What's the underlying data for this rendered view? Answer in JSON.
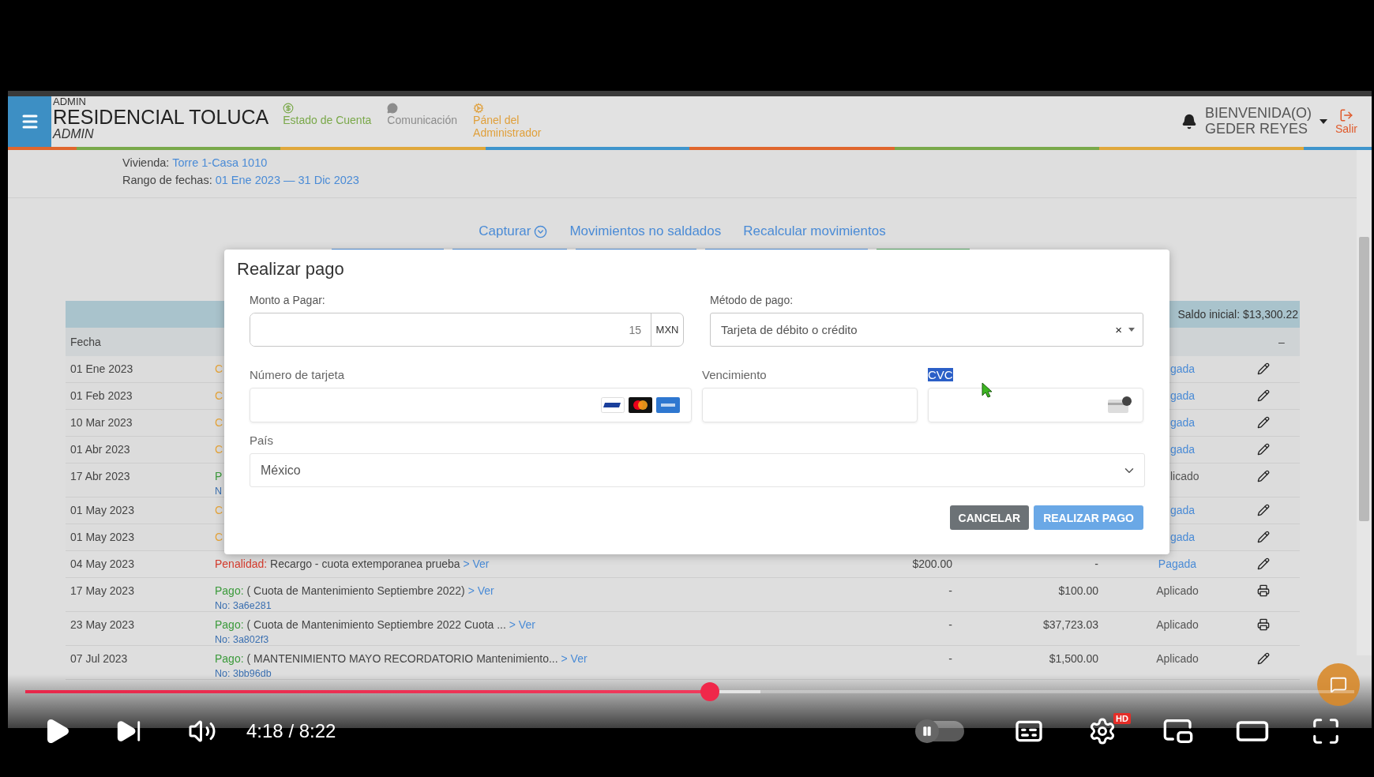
{
  "app": {
    "role_top": "ADMIN",
    "name": "RESIDENCIAL TOLUCA",
    "role_bottom": "ADMIN",
    "nav": [
      {
        "label": "Estado de Cuenta",
        "kind": "account",
        "color": "#7aa84a"
      },
      {
        "label": "Comunicación",
        "kind": "chat",
        "color": "#8c8c8c"
      },
      {
        "label": "Pánel del Administrador",
        "kind": "admin",
        "color": "#e0a03c"
      }
    ],
    "user": {
      "greeting": "BIENVENIDA(O)",
      "name": "GEDER REYES",
      "logout": "Salir"
    }
  },
  "info": [
    {
      "label": "Vivienda:",
      "value": "Torre 1-Casa 1010"
    },
    {
      "label": "Rango de fechas:",
      "value": "01 Ene 2023 — 31 Dic 2023"
    }
  ],
  "tabs": [
    {
      "label": "Capturar",
      "kind": "dropdown"
    },
    {
      "label": "Movimientos no saldados",
      "kind": "link"
    },
    {
      "label": "Recalcular movimientos",
      "kind": "link"
    }
  ],
  "table": {
    "balance": "Saldo inicial: $13,300.22",
    "date_header": "Fecha",
    "action_header": "–",
    "rows": [
      {
        "date": "01 Ene 2023",
        "kind": "cargo",
        "label": "C",
        "status": {
          "text": "gada",
          "color": "#4a8bd6"
        },
        "printable": false,
        "covered": true
      },
      {
        "date": "01 Feb 2023",
        "kind": "cargo",
        "label": "C",
        "status": {
          "text": "gada",
          "color": "#4a8bd6"
        },
        "printable": false,
        "covered": true
      },
      {
        "date": "10 Mar 2023",
        "kind": "cargo",
        "label": "C",
        "status": {
          "text": "gada",
          "color": "#4a8bd6"
        },
        "printable": false,
        "covered": true
      },
      {
        "date": "01 Abr 2023",
        "kind": "cargo",
        "label": "C",
        "status": {
          "text": "gada",
          "color": "#4a8bd6"
        },
        "printable": false,
        "covered": true
      },
      {
        "date": "17 Abr 2023",
        "kind": "pago",
        "label": "P",
        "ref": "N",
        "status": {
          "text": "licado",
          "color": "#555555"
        },
        "printable": false,
        "covered": true
      },
      {
        "date": "01 May 2023",
        "kind": "cargo",
        "label": "C",
        "status": {
          "text": "gada",
          "color": "#4a8bd6"
        },
        "printable": false,
        "covered": true
      },
      {
        "date": "01 May 2023",
        "kind": "cargo",
        "label": "C",
        "status": {
          "text": "gada",
          "color": "#4a8bd6"
        },
        "printable": false,
        "covered": true
      },
      {
        "date": "04 May 2023",
        "kind": "penalidad",
        "label": "Penalidad:",
        "text": "Recargo - cuota extemporanea prueba",
        "link": "> Ver",
        "charge": "$200.00",
        "payment": "-",
        "status": {
          "text": "Pagada",
          "color": "#4a8bd6"
        },
        "printable": false,
        "covered": false
      },
      {
        "date": "17 May 2023",
        "kind": "pago",
        "label": "Pago:",
        "text": "( Cuota de Mantenimiento Septiembre 2022)",
        "link": "> Ver",
        "ref": "No: 3a6e281",
        "charge": "-",
        "payment": "$100.00",
        "status": {
          "text": "Aplicado",
          "color": "#555555"
        },
        "printable": true,
        "covered": false
      },
      {
        "date": "23 May 2023",
        "kind": "pago",
        "label": "Pago:",
        "text": "( Cuota de Mantenimiento Septiembre 2022 Cuota ...",
        "link": "> Ver",
        "ref": "No: 3a802f3",
        "charge": "-",
        "payment": "$37,723.03",
        "status": {
          "text": "Aplicado",
          "color": "#555555"
        },
        "printable": true,
        "covered": false
      },
      {
        "date": "07 Jul 2023",
        "kind": "pago",
        "label": "Pago:",
        "text": "( MANTENIMIENTO MAYO RECORDATORIO Mantenimiento...",
        "link": "> Ver",
        "ref": "No: 3bb96db",
        "charge": "-",
        "payment": "$1,500.00",
        "status": {
          "text": "Aplicado",
          "color": "#555555"
        },
        "printable": false,
        "covered": false
      }
    ]
  },
  "modal": {
    "title": "Realizar pago",
    "amount": {
      "label": "Monto a Pagar:",
      "value": "15",
      "currency": "MXN"
    },
    "method": {
      "label": "Método de pago:",
      "value": "Tarjeta de débito o crédito",
      "clear": "×"
    },
    "card": {
      "label": "Número de tarjeta"
    },
    "expiry": {
      "label": "Vencimiento"
    },
    "cvc": {
      "label": "CVC",
      "highlighted": true
    },
    "country": {
      "label": "País",
      "value": "México"
    },
    "buttons": [
      {
        "label": "CANCELAR",
        "kind": "secondary"
      },
      {
        "label": "REALIZAR PAGO",
        "kind": "primary"
      }
    ]
  },
  "player": {
    "time": "4:18 / 8:22",
    "progress": {
      "level": 0.515
    },
    "buffer": {
      "level": 0.553
    },
    "hd_badge": "HD",
    "autoplay": {
      "on": false
    }
  }
}
